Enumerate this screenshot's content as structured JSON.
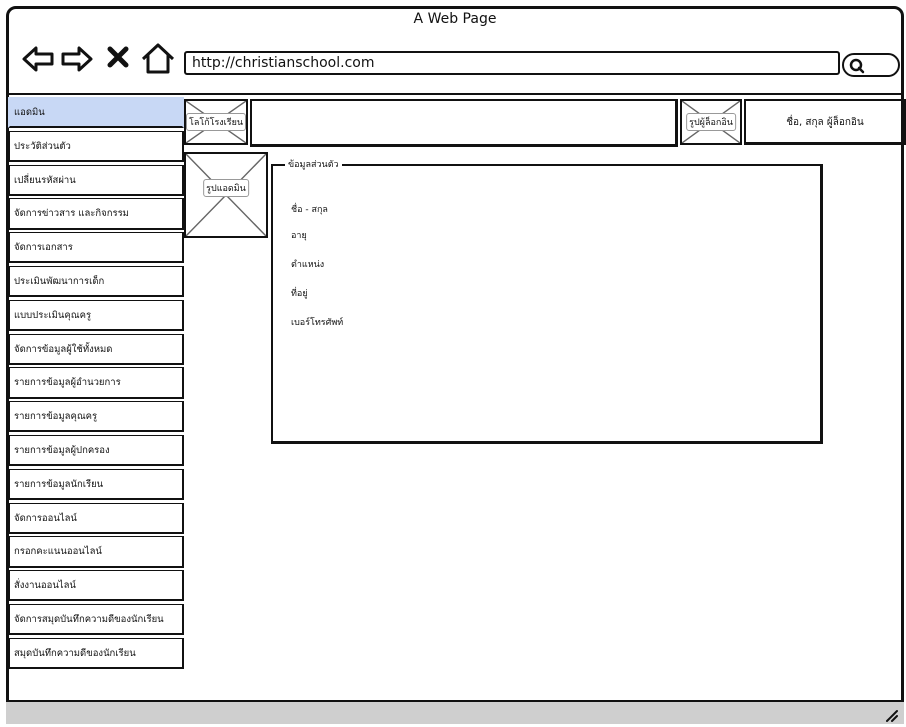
{
  "window": {
    "title": "A Web Page"
  },
  "browser": {
    "url": "http://christianschool.com"
  },
  "sidebar": {
    "items": [
      {
        "label": "แอดมิน",
        "active": true
      },
      {
        "label": "ประวัติส่วนตัว"
      },
      {
        "label": "เปลี่ยนรหัสผ่าน"
      },
      {
        "label": "จัดการข่าวสาร และกิจกรรม"
      },
      {
        "label": "จัดการเอกสาร"
      },
      {
        "label": "ประเมินพัฒนาการเด็ก"
      },
      {
        "label": "แบบประเมินคุณครู"
      },
      {
        "label": "จัดการข้อมูลผู้ใช้ทั้งหมด"
      },
      {
        "label": "รายการข้อมูลผู้อำนวยการ"
      },
      {
        "label": "รายการข้อมูลคุณครู"
      },
      {
        "label": "รายการข้อมูลผู้ปกครอง"
      },
      {
        "label": "รายการข้อมูลนักเรียน"
      },
      {
        "label": "จัดการออนไลน์"
      },
      {
        "label": "กรอกคะแนนออนไลน์"
      },
      {
        "label": "สั่งงานออนไลน์"
      },
      {
        "label": "จัดการสมุดบันทึกความดีของนักเรียน"
      },
      {
        "label": "สมุดบันทึกความดีของนักเรียน"
      }
    ]
  },
  "header": {
    "logo_label": "โลโก้โรงเรียน",
    "user_photo_label": "รูปผู้ล็อกอิน",
    "user_name": "ชื่อ, สกุล ผู้ล็อกอิน"
  },
  "main": {
    "admin_photo_label": "รูปแอดมิน",
    "section_title": "ข้อมูลส่วนตัว",
    "fields": [
      {
        "label": "ชื่อ - สกุล"
      },
      {
        "label": "อายุ"
      },
      {
        "label": "ตำแหน่ง"
      },
      {
        "label": "ที่อยู่"
      },
      {
        "label": "เบอร์โทรศัพท์"
      }
    ]
  },
  "colors": {
    "active_item": "#c8d8f5",
    "statusbar": "#cfcfcf"
  },
  "icons": [
    "back-icon",
    "forward-icon",
    "close-icon",
    "home-icon",
    "search-icon",
    "resize-handle-icon"
  ]
}
